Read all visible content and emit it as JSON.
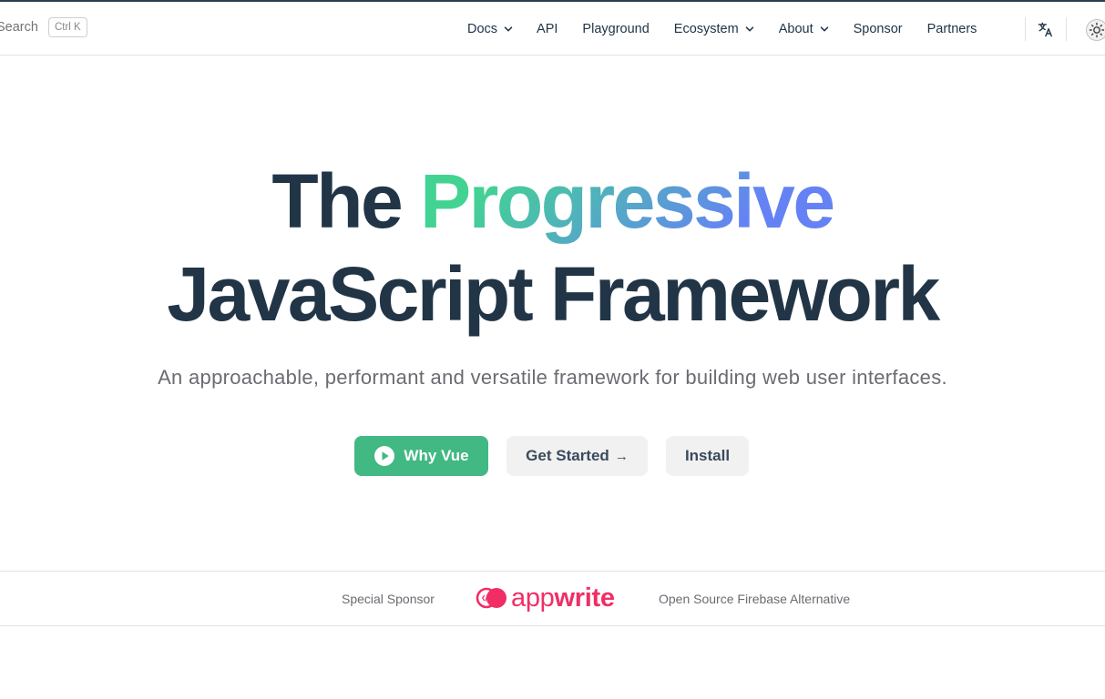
{
  "nav": {
    "search_label": "Search",
    "search_shortcut": "Ctrl K",
    "items": [
      {
        "label": "Docs",
        "dropdown": true
      },
      {
        "label": "API",
        "dropdown": false
      },
      {
        "label": "Playground",
        "dropdown": false
      },
      {
        "label": "Ecosystem",
        "dropdown": true
      },
      {
        "label": "About",
        "dropdown": true
      },
      {
        "label": "Sponsor",
        "dropdown": false
      },
      {
        "label": "Partners",
        "dropdown": false
      }
    ],
    "icons": [
      "translate-icon",
      "sun-icon"
    ]
  },
  "hero": {
    "title_part1": "The",
    "title_highlight": "Progressive",
    "title_line2": "JavaScript Framework",
    "tagline": "An approachable, performant and versatile framework for building web user interfaces."
  },
  "actions": {
    "primary_label": "Why Vue",
    "started_label": "Get Started",
    "started_arrow": "→",
    "install_label": "Install"
  },
  "sponsor": {
    "label": "Special Sponsor",
    "brand_light": "app",
    "brand_bold": "write",
    "description": "Open Source Firebase Alternative"
  },
  "colors": {
    "brand_green": "#42b883",
    "text_dark": "#213547",
    "gradient_start": "#42d392",
    "gradient_end": "#6582f5",
    "appwrite_pink": "#f02e65"
  }
}
